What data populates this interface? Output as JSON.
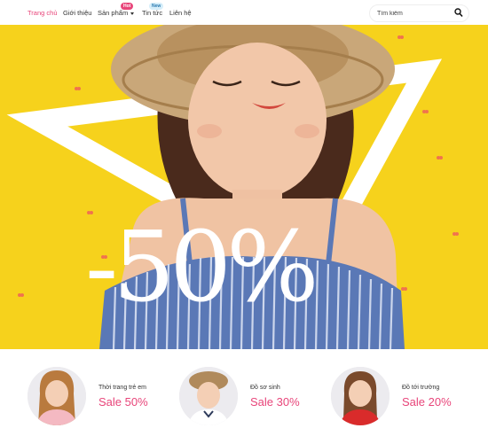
{
  "nav": {
    "items": [
      {
        "label": "Trang chủ"
      },
      {
        "label": "Giới thiệu"
      },
      {
        "label": "Sản phẩm",
        "badge": "Hot"
      },
      {
        "label": "Tin tức",
        "badge": "New"
      },
      {
        "label": "Liên hệ"
      }
    ]
  },
  "search": {
    "placeholder": "Tìm kiếm",
    "icon": "search-icon"
  },
  "hero": {
    "promo": "-50%"
  },
  "categories": [
    {
      "title": "Thời trang trẻ em",
      "sale": "Sale 50%"
    },
    {
      "title": "Đồ sơ sinh",
      "sale": "Sale 30%"
    },
    {
      "title": "Đồ tới trường",
      "sale": "Sale 20%"
    }
  ],
  "colors": {
    "accent": "#e8457a",
    "hero_bg": "#f6d21c"
  }
}
